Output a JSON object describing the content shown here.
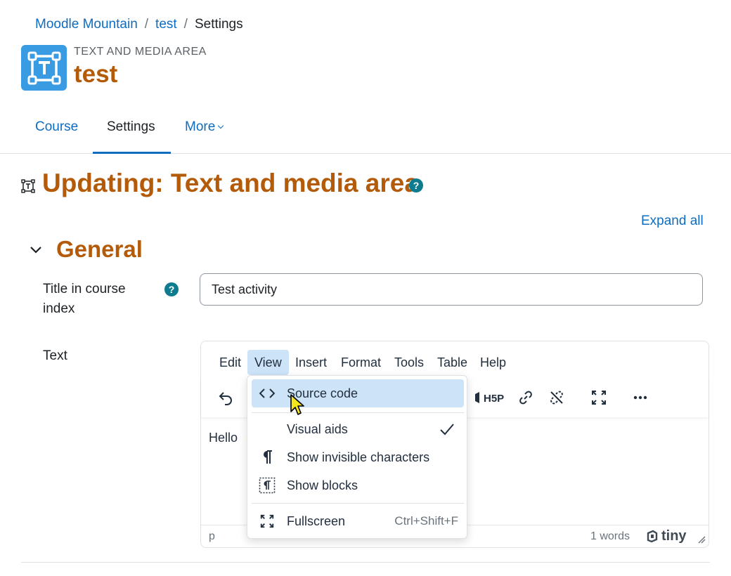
{
  "breadcrumb": {
    "items": [
      "Moodle Mountain",
      "test",
      "Settings"
    ],
    "separator": "/"
  },
  "activity_header": {
    "type_label": "TEXT AND MEDIA AREA",
    "name": "test",
    "icon": "text-media-area-icon"
  },
  "secondary_nav": {
    "tabs": [
      {
        "label": "Course"
      },
      {
        "label": "Settings",
        "active": true
      },
      {
        "label": "More"
      }
    ]
  },
  "page": {
    "title": "Updating: Text and media area",
    "expand_all": "Expand all"
  },
  "general_section": {
    "title": "General",
    "title_field": {
      "label": "Title in course index",
      "value": "Test activity"
    },
    "text_field": {
      "label": "Text"
    }
  },
  "editor": {
    "menus": [
      "Edit",
      "View",
      "Insert",
      "Format",
      "Tools",
      "Table",
      "Help"
    ],
    "active_menu": "View",
    "content": "Hello",
    "status_path": "p",
    "word_count": "1 words",
    "brand": "tiny"
  },
  "view_menu": {
    "items": [
      {
        "label": "Source code",
        "icon": "source-code-icon",
        "highlighted": true
      },
      {
        "label": "Visual aids",
        "checked": true
      },
      {
        "label": "Show invisible characters",
        "icon": "pilcrow-icon"
      },
      {
        "label": "Show blocks",
        "icon": "show-blocks-icon"
      },
      {
        "label": "Fullscreen",
        "icon": "fullscreen-icon",
        "shortcut": "Ctrl+Shift+F"
      }
    ]
  },
  "colors": {
    "link": "#0f6cbf",
    "heading": "#b45b0a",
    "help": "#0f7b8f",
    "activity_icon_bg": "#399be2",
    "menu_highlight": "#cde3f7"
  }
}
